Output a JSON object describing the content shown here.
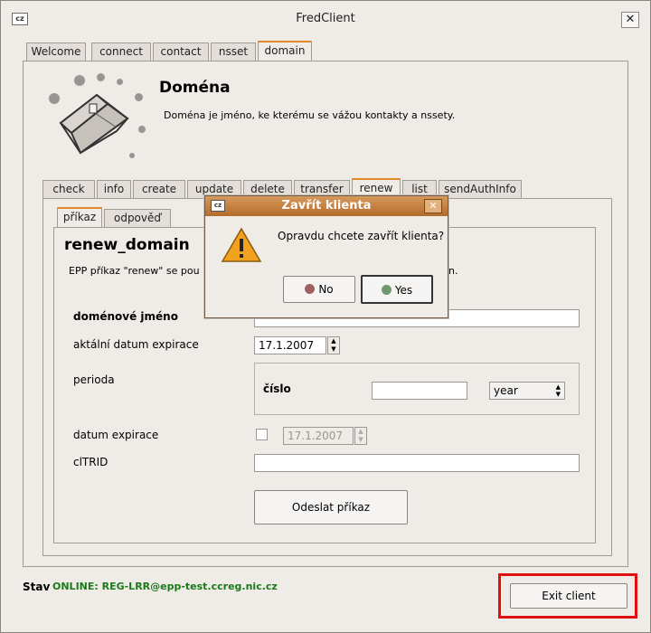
{
  "window": {
    "title": "FredClient",
    "icon_text": "cz",
    "close_glyph": "✕"
  },
  "top_tabs": [
    {
      "label": "Welcome"
    },
    {
      "label": "connect"
    },
    {
      "label": "contact"
    },
    {
      "label": "nsset"
    },
    {
      "label": "domain",
      "active": true
    }
  ],
  "header": {
    "title": "Doména",
    "description": "Doména je jméno, ke kterému se vážou kontakty a nssety."
  },
  "command_tabs": [
    {
      "label": "check"
    },
    {
      "label": "info"
    },
    {
      "label": "create"
    },
    {
      "label": "update"
    },
    {
      "label": "delete"
    },
    {
      "label": "transfer"
    },
    {
      "label": "renew",
      "active": true
    },
    {
      "label": "list"
    },
    {
      "label": "sendAuthInfo"
    }
  ],
  "sub_tabs": [
    {
      "label": "příkaz",
      "active": true
    },
    {
      "label": "odpověď"
    }
  ],
  "form": {
    "title": "renew_domain",
    "intro_left": "EPP příkaz \"renew\" se pou",
    "intro_right": "n.",
    "domain_name_label": "doménové jméno",
    "domain_name_value": "",
    "cur_exp_label": "aktální datum expirace",
    "cur_exp_value": "17.1.2007",
    "period_label": "perioda",
    "number_label": "číslo",
    "number_value": "",
    "unit_value": "year",
    "exp_date_label": "datum expirace",
    "exp_date_value": "17.1.2007",
    "cltrid_label": "clTRID",
    "cltrid_value": "",
    "submit_label": "Odeslat příkaz"
  },
  "status": {
    "label": "Stav",
    "value": "ONLINE: REG-LRR@epp-test.ccreg.nic.cz"
  },
  "exit_button": {
    "label": "Exit client"
  },
  "dialog": {
    "title": "Zavřít klienta",
    "icon_text": "cz",
    "close_glyph": "✕",
    "message": "Opravdu chcete zavřít klienta?",
    "no_label": "No",
    "yes_label": "Yes"
  },
  "colors": {
    "accent": "#e08a2a",
    "status_online": "#1a7a1a",
    "highlight": "#e01010"
  }
}
